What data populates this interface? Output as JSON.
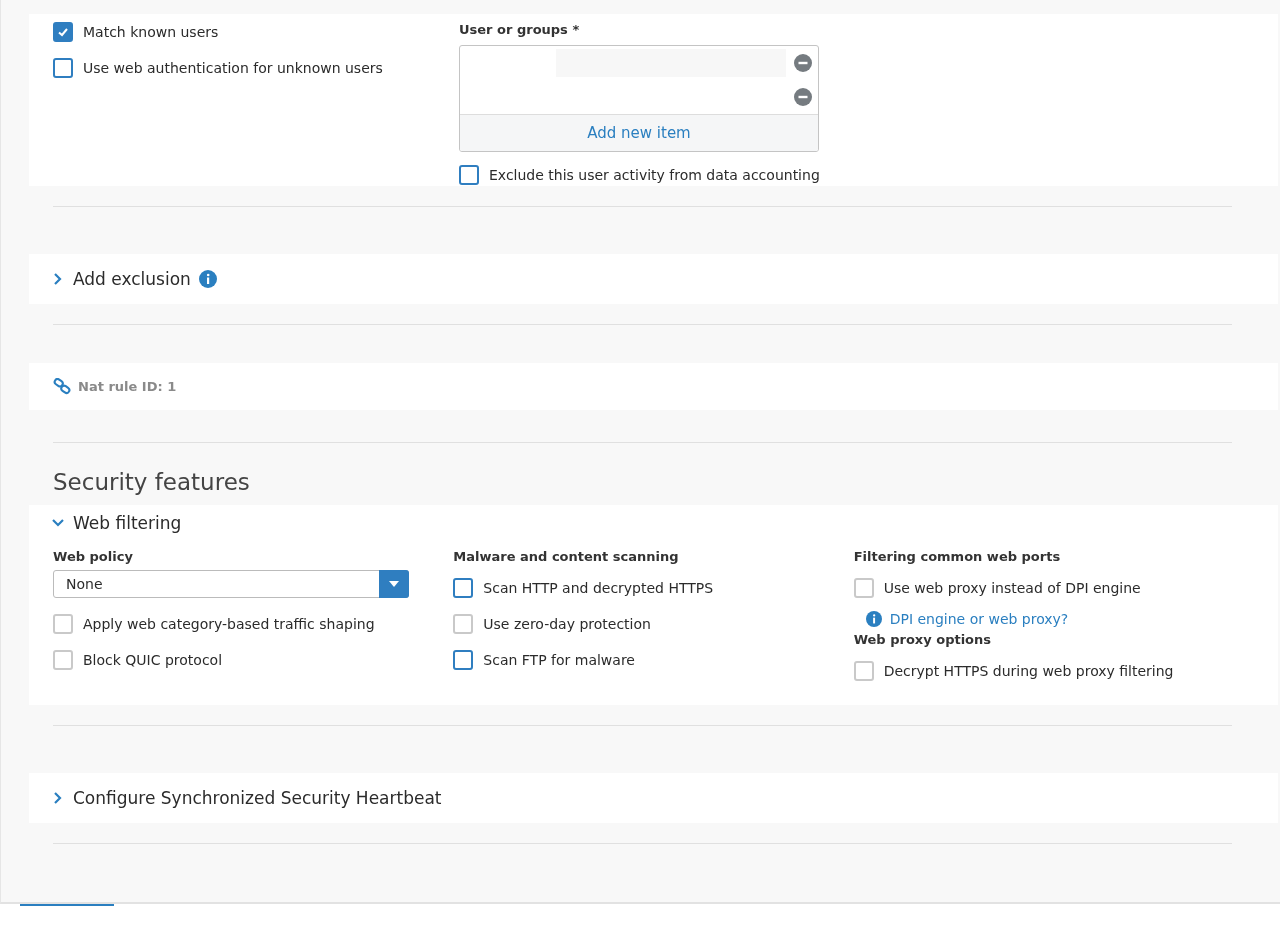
{
  "identity": {
    "options": [
      {
        "label": "Match known users",
        "checked": true,
        "disabled": false
      },
      {
        "label": "Use web authentication for unknown users",
        "checked": false,
        "disabled": false
      }
    ],
    "users": {
      "label": "User or groups *",
      "items": [
        {
          "removable": true
        },
        {
          "removable": true
        }
      ],
      "add_label": "Add new item"
    },
    "exclude": {
      "label": "Exclude this user activity from data accounting",
      "checked": false,
      "disabled": false
    }
  },
  "exclusion": {
    "title": "Add exclusion",
    "expanded": false
  },
  "nat": {
    "label": "Nat rule ID: 1"
  },
  "security": {
    "heading": "Security features",
    "web_filtering": {
      "title": "Web filtering",
      "expanded": true,
      "columns": [
        {
          "items": [
            {
              "kind": "heading",
              "label": "Web policy"
            },
            {
              "kind": "select",
              "value": "None"
            },
            {
              "kind": "checkbox",
              "label": "Apply web category-based traffic shaping",
              "checked": false,
              "disabled": true
            },
            {
              "kind": "checkbox",
              "label": "Block QUIC protocol",
              "checked": false,
              "disabled": true
            }
          ]
        },
        {
          "items": [
            {
              "kind": "heading",
              "label": "Malware and content scanning"
            },
            {
              "kind": "checkbox",
              "label": "Scan HTTP and decrypted HTTPS",
              "checked": false,
              "disabled": false
            },
            {
              "kind": "checkbox",
              "label": "Use zero-day protection",
              "checked": false,
              "disabled": true
            },
            {
              "kind": "checkbox",
              "label": "Scan FTP for malware",
              "checked": false,
              "disabled": false
            }
          ]
        },
        {
          "items": [
            {
              "kind": "heading",
              "label": "Filtering common web ports"
            },
            {
              "kind": "checkbox",
              "label": "Use web proxy instead of DPI engine",
              "checked": false,
              "disabled": true
            },
            {
              "kind": "link",
              "label": "DPI engine or web proxy?"
            },
            {
              "kind": "heading",
              "label": "Web proxy options"
            },
            {
              "kind": "checkbox",
              "label": "Decrypt HTTPS during web proxy filtering",
              "checked": false,
              "disabled": true
            }
          ]
        }
      ]
    },
    "heartbeat": {
      "title": "Configure Synchronized Security Heartbeat",
      "expanded": false
    }
  }
}
